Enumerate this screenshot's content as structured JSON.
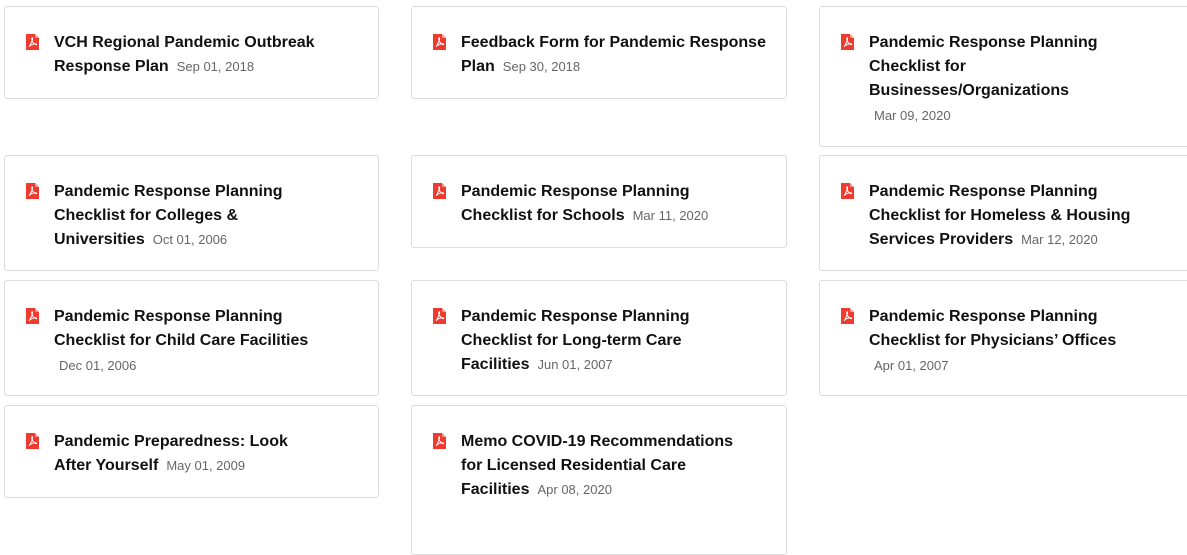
{
  "colors": {
    "pdf_icon": "#ee3a2f",
    "title": "#111111",
    "date": "#666666",
    "card_border": "#dcdcdc"
  },
  "icons": {
    "document": "pdf-file-icon"
  },
  "documents": [
    {
      "title": "VCH Regional Pandemic Outbreak Response Plan",
      "date": "Sep 01, 2018"
    },
    {
      "title": "Feedback Form for Pandemic Response Plan",
      "date": "Sep 30, 2018"
    },
    {
      "title": "Pandemic Response Planning Checklist for Businesses/Organizations",
      "date": "Mar 09, 2020"
    },
    {
      "title": "Pandemic Response Planning Checklist for Colleges & Universities",
      "date": "Oct 01, 2006"
    },
    {
      "title": "Pandemic Response Planning Checklist for Schools",
      "date": "Mar 11, 2020"
    },
    {
      "title": "Pandemic Response Planning Checklist for Homeless & Housing Services Providers",
      "date": "Mar 12, 2020"
    },
    {
      "title": "Pandemic Response Planning Checklist for Child Care Facilities",
      "date": "Dec 01, 2006"
    },
    {
      "title": "Pandemic Response Planning Checklist for Long-term Care Facilities",
      "date": "Jun 01, 2007"
    },
    {
      "title": "Pandemic Response Planning Checklist for Physicians’ Offices",
      "date": "Apr 01, 2007"
    },
    {
      "title": "Pandemic Preparedness: Look After Yourself",
      "date": "May 01, 2009"
    },
    {
      "title": "Memo COVID-19 Recommendations for Licensed Residential Care Facilities",
      "date": "Apr 08, 2020"
    }
  ]
}
